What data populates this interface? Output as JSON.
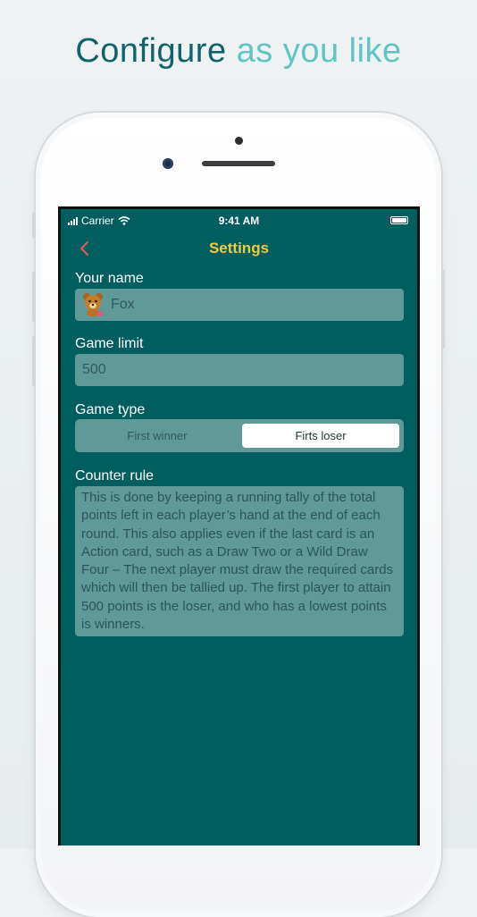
{
  "headline": {
    "part1": "Configure",
    "part2": "as you like"
  },
  "status_bar": {
    "carrier": "Carrier",
    "time": "9:41 AM"
  },
  "nav": {
    "title": "Settings",
    "back_icon": "chevron-left-icon"
  },
  "form": {
    "name": {
      "label": "Your name",
      "value": "Fox",
      "avatar_icon": "bear-avatar-icon"
    },
    "game_limit": {
      "label": "Game limit",
      "value": "500"
    },
    "game_type": {
      "label": "Game type",
      "options": [
        "First winner",
        "Firts loser"
      ],
      "selected": "Firts loser"
    },
    "counter_rule": {
      "label": "Counter rule",
      "text": "This is done by keeping a running tally of the total points left in each player’s hand at the end of each round. This also applies even if the last card is an Action card, such as a Draw Two or a Wild Draw Four – The next player must draw the required cards which will then be tallied up. The first player to attain 500 points is the loser, and who has a lowest points is winners."
    }
  },
  "colors": {
    "screen_bg": "#005e5e",
    "field_bg": "#5f9a98",
    "title": "#f2c84b",
    "back": "#e05a5a",
    "headline_dark": "#13626a",
    "headline_light": "#5fc4c3"
  }
}
